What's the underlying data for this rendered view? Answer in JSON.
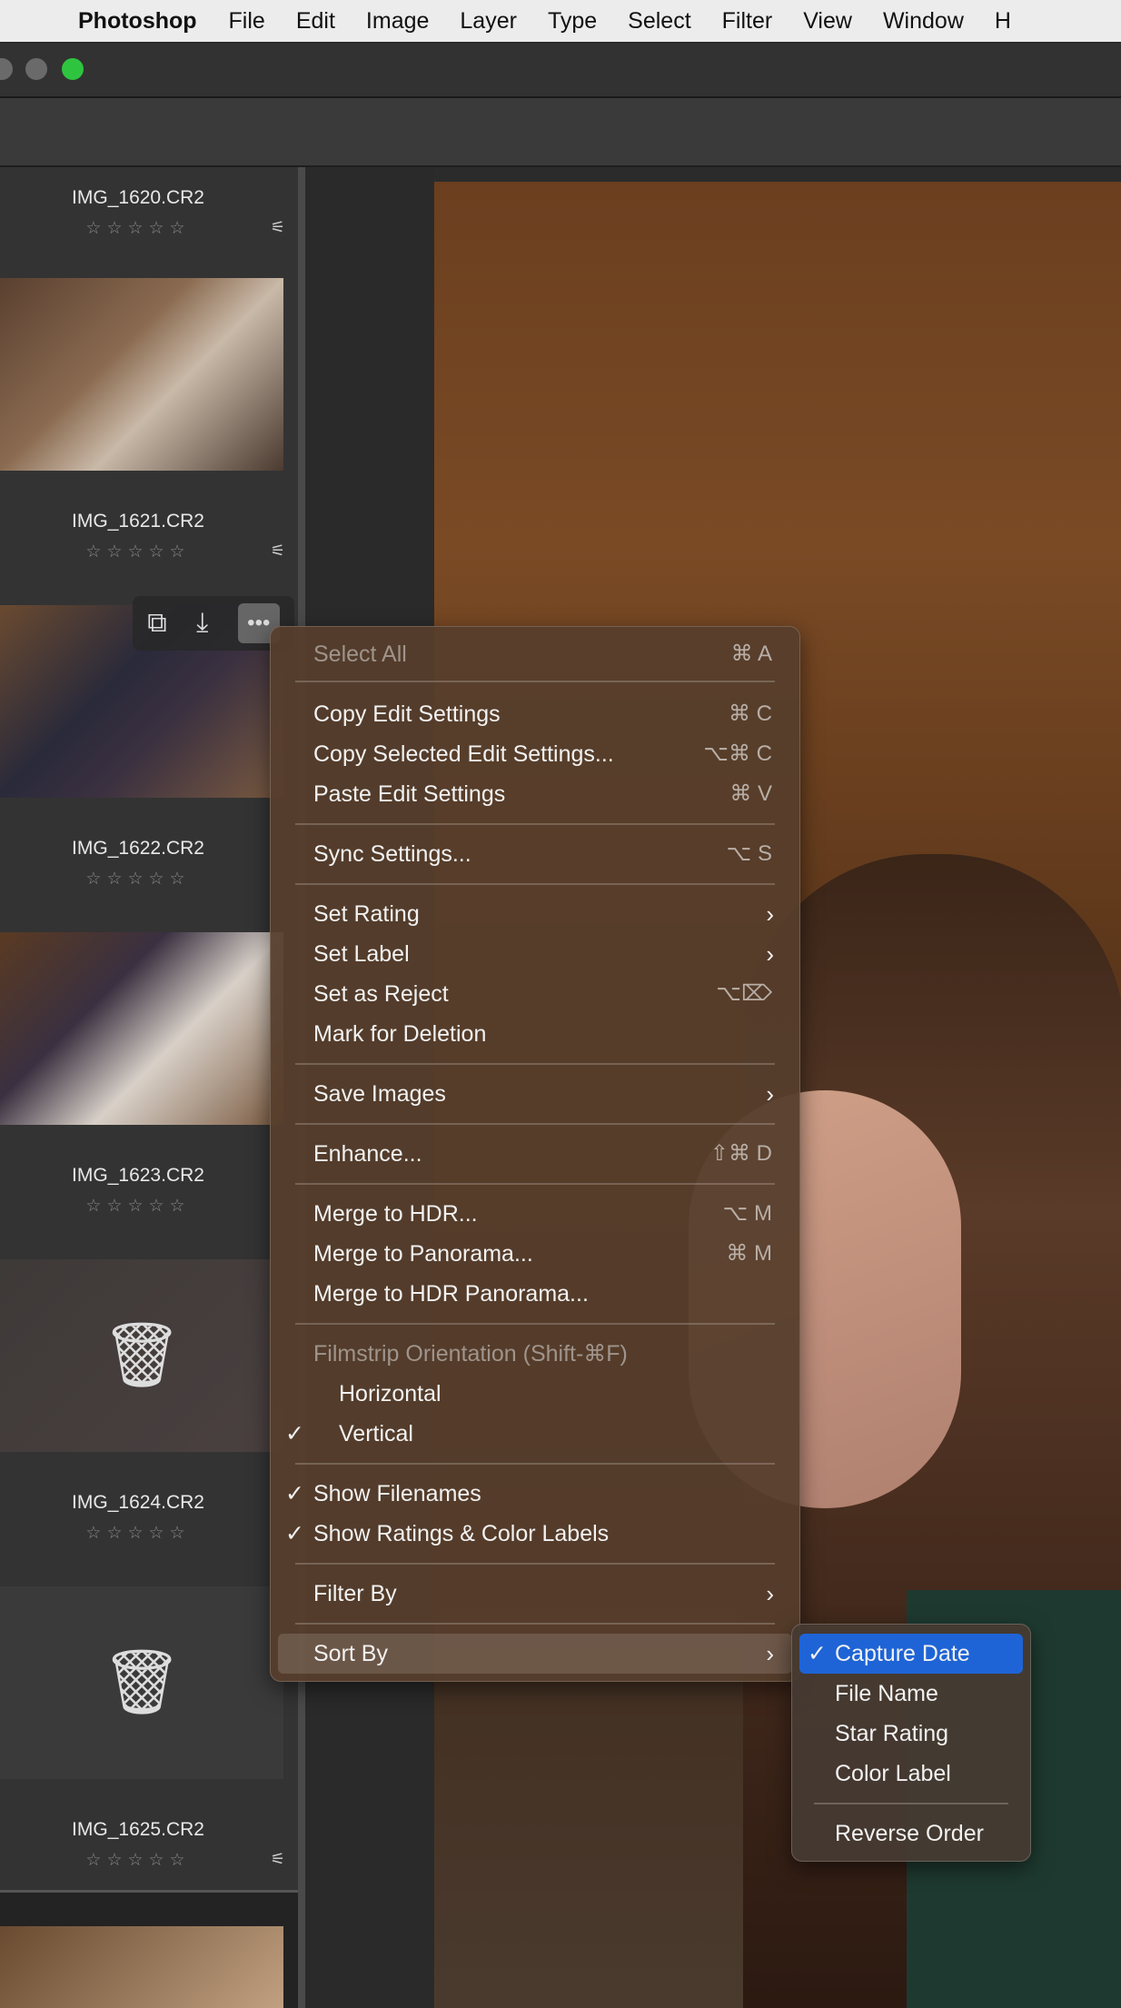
{
  "menubar": {
    "app": "Photoshop",
    "items": [
      "File",
      "Edit",
      "Image",
      "Layer",
      "Type",
      "Select",
      "Filter",
      "View",
      "Window",
      "H"
    ]
  },
  "filmstrip": {
    "items": [
      {
        "name": "IMG_1620.CR2",
        "stars": "☆☆☆☆☆"
      },
      {
        "name": "IMG_1621.CR2",
        "stars": "☆☆☆☆☆"
      },
      {
        "name": "IMG_1622.CR2",
        "stars": "☆☆☆☆☆"
      },
      {
        "name": "IMG_1623.CR2",
        "stars": "☆☆☆☆☆"
      },
      {
        "name": "IMG_1624.CR2",
        "stars": "☆☆☆☆☆"
      },
      {
        "name": "IMG_1625.CR2",
        "stars": "☆☆☆☆☆"
      }
    ]
  },
  "context_menu": {
    "select_all": {
      "label": "Select All",
      "shortcut": "⌘ A"
    },
    "copy_edit": {
      "label": "Copy Edit Settings",
      "shortcut": "⌘ C"
    },
    "copy_selected": {
      "label": "Copy Selected Edit Settings...",
      "shortcut": "⌥⌘ C"
    },
    "paste_edit": {
      "label": "Paste Edit Settings",
      "shortcut": "⌘ V"
    },
    "sync": {
      "label": "Sync Settings...",
      "shortcut": "⌥ S"
    },
    "set_rating": {
      "label": "Set Rating"
    },
    "set_label": {
      "label": "Set Label"
    },
    "set_reject": {
      "label": "Set as Reject",
      "shortcut": "⌥⌦"
    },
    "mark_deletion": {
      "label": "Mark for Deletion"
    },
    "save_images": {
      "label": "Save Images"
    },
    "enhance": {
      "label": "Enhance...",
      "shortcut": "⇧⌘ D"
    },
    "merge_hdr": {
      "label": "Merge to HDR...",
      "shortcut": "⌥ M"
    },
    "merge_pano": {
      "label": "Merge to Panorama...",
      "shortcut": "⌘ M"
    },
    "merge_hdr_pano": {
      "label": "Merge to HDR Panorama..."
    },
    "orientation_header": {
      "label": "Filmstrip Orientation (Shift-⌘F)"
    },
    "horizontal": {
      "label": "Horizontal"
    },
    "vertical": {
      "label": "Vertical"
    },
    "show_filenames": {
      "label": "Show Filenames"
    },
    "show_ratings": {
      "label": "Show Ratings & Color Labels"
    },
    "filter_by": {
      "label": "Filter By"
    },
    "sort_by": {
      "label": "Sort By"
    },
    "check": "✓",
    "arrow": "›"
  },
  "sort_submenu": {
    "items": [
      "Capture Date",
      "File Name",
      "Star Rating",
      "Color Label"
    ],
    "reverse": "Reverse Order"
  },
  "icons": {
    "trash": "🗑",
    "adjust": "⚟",
    "more": "•••",
    "sliders": "⧉",
    "download": "⤓"
  }
}
